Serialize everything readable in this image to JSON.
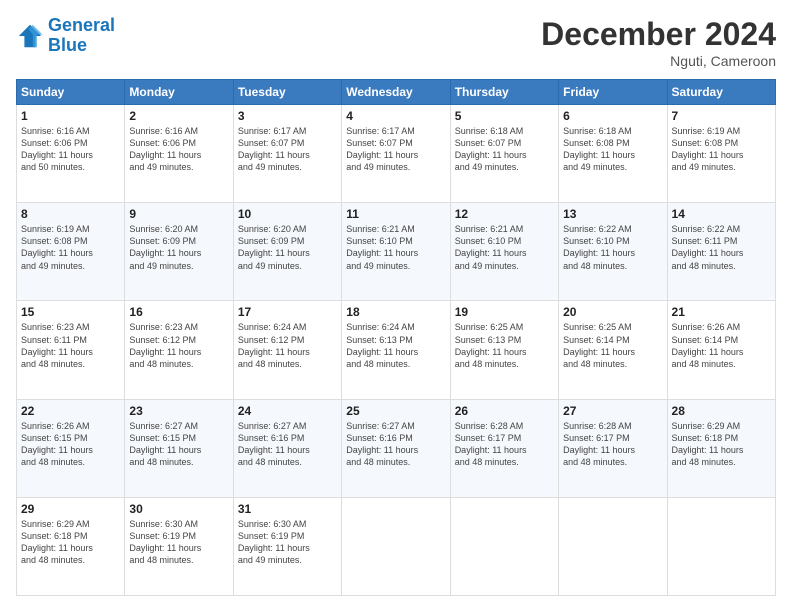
{
  "header": {
    "logo_line1": "General",
    "logo_line2": "Blue",
    "main_title": "December 2024",
    "subtitle": "Nguti, Cameroon"
  },
  "days_of_week": [
    "Sunday",
    "Monday",
    "Tuesday",
    "Wednesday",
    "Thursday",
    "Friday",
    "Saturday"
  ],
  "weeks": [
    [
      {
        "day": 1,
        "info": "Sunrise: 6:16 AM\nSunset: 6:06 PM\nDaylight: 11 hours\nand 50 minutes."
      },
      {
        "day": 2,
        "info": "Sunrise: 6:16 AM\nSunset: 6:06 PM\nDaylight: 11 hours\nand 49 minutes."
      },
      {
        "day": 3,
        "info": "Sunrise: 6:17 AM\nSunset: 6:07 PM\nDaylight: 11 hours\nand 49 minutes."
      },
      {
        "day": 4,
        "info": "Sunrise: 6:17 AM\nSunset: 6:07 PM\nDaylight: 11 hours\nand 49 minutes."
      },
      {
        "day": 5,
        "info": "Sunrise: 6:18 AM\nSunset: 6:07 PM\nDaylight: 11 hours\nand 49 minutes."
      },
      {
        "day": 6,
        "info": "Sunrise: 6:18 AM\nSunset: 6:08 PM\nDaylight: 11 hours\nand 49 minutes."
      },
      {
        "day": 7,
        "info": "Sunrise: 6:19 AM\nSunset: 6:08 PM\nDaylight: 11 hours\nand 49 minutes."
      }
    ],
    [
      {
        "day": 8,
        "info": "Sunrise: 6:19 AM\nSunset: 6:08 PM\nDaylight: 11 hours\nand 49 minutes."
      },
      {
        "day": 9,
        "info": "Sunrise: 6:20 AM\nSunset: 6:09 PM\nDaylight: 11 hours\nand 49 minutes."
      },
      {
        "day": 10,
        "info": "Sunrise: 6:20 AM\nSunset: 6:09 PM\nDaylight: 11 hours\nand 49 minutes."
      },
      {
        "day": 11,
        "info": "Sunrise: 6:21 AM\nSunset: 6:10 PM\nDaylight: 11 hours\nand 49 minutes."
      },
      {
        "day": 12,
        "info": "Sunrise: 6:21 AM\nSunset: 6:10 PM\nDaylight: 11 hours\nand 49 minutes."
      },
      {
        "day": 13,
        "info": "Sunrise: 6:22 AM\nSunset: 6:10 PM\nDaylight: 11 hours\nand 48 minutes."
      },
      {
        "day": 14,
        "info": "Sunrise: 6:22 AM\nSunset: 6:11 PM\nDaylight: 11 hours\nand 48 minutes."
      }
    ],
    [
      {
        "day": 15,
        "info": "Sunrise: 6:23 AM\nSunset: 6:11 PM\nDaylight: 11 hours\nand 48 minutes."
      },
      {
        "day": 16,
        "info": "Sunrise: 6:23 AM\nSunset: 6:12 PM\nDaylight: 11 hours\nand 48 minutes."
      },
      {
        "day": 17,
        "info": "Sunrise: 6:24 AM\nSunset: 6:12 PM\nDaylight: 11 hours\nand 48 minutes."
      },
      {
        "day": 18,
        "info": "Sunrise: 6:24 AM\nSunset: 6:13 PM\nDaylight: 11 hours\nand 48 minutes."
      },
      {
        "day": 19,
        "info": "Sunrise: 6:25 AM\nSunset: 6:13 PM\nDaylight: 11 hours\nand 48 minutes."
      },
      {
        "day": 20,
        "info": "Sunrise: 6:25 AM\nSunset: 6:14 PM\nDaylight: 11 hours\nand 48 minutes."
      },
      {
        "day": 21,
        "info": "Sunrise: 6:26 AM\nSunset: 6:14 PM\nDaylight: 11 hours\nand 48 minutes."
      }
    ],
    [
      {
        "day": 22,
        "info": "Sunrise: 6:26 AM\nSunset: 6:15 PM\nDaylight: 11 hours\nand 48 minutes."
      },
      {
        "day": 23,
        "info": "Sunrise: 6:27 AM\nSunset: 6:15 PM\nDaylight: 11 hours\nand 48 minutes."
      },
      {
        "day": 24,
        "info": "Sunrise: 6:27 AM\nSunset: 6:16 PM\nDaylight: 11 hours\nand 48 minutes."
      },
      {
        "day": 25,
        "info": "Sunrise: 6:27 AM\nSunset: 6:16 PM\nDaylight: 11 hours\nand 48 minutes."
      },
      {
        "day": 26,
        "info": "Sunrise: 6:28 AM\nSunset: 6:17 PM\nDaylight: 11 hours\nand 48 minutes."
      },
      {
        "day": 27,
        "info": "Sunrise: 6:28 AM\nSunset: 6:17 PM\nDaylight: 11 hours\nand 48 minutes."
      },
      {
        "day": 28,
        "info": "Sunrise: 6:29 AM\nSunset: 6:18 PM\nDaylight: 11 hours\nand 48 minutes."
      }
    ],
    [
      {
        "day": 29,
        "info": "Sunrise: 6:29 AM\nSunset: 6:18 PM\nDaylight: 11 hours\nand 48 minutes."
      },
      {
        "day": 30,
        "info": "Sunrise: 6:30 AM\nSunset: 6:19 PM\nDaylight: 11 hours\nand 48 minutes."
      },
      {
        "day": 31,
        "info": "Sunrise: 6:30 AM\nSunset: 6:19 PM\nDaylight: 11 hours\nand 49 minutes."
      },
      {
        "day": null,
        "info": ""
      },
      {
        "day": null,
        "info": ""
      },
      {
        "day": null,
        "info": ""
      },
      {
        "day": null,
        "info": ""
      }
    ]
  ]
}
